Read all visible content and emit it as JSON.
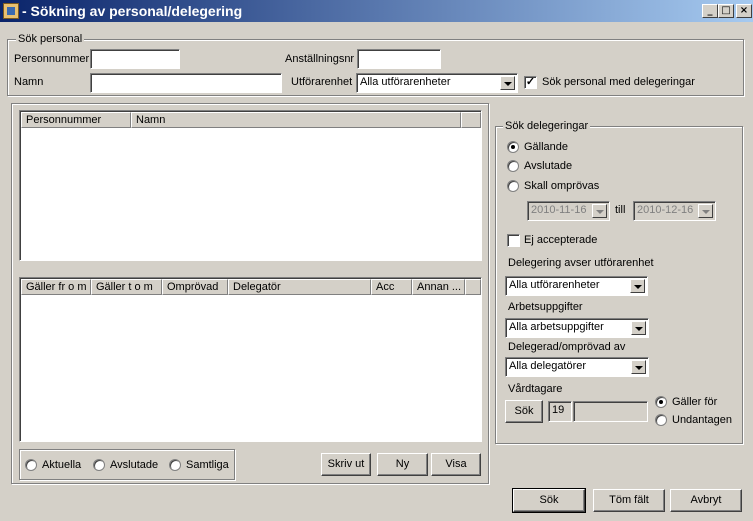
{
  "window": {
    "title": "- Sökning av personal/delegering",
    "minimize_glyph": "_",
    "maximize_glyph": "□",
    "close_glyph": "×"
  },
  "sok_personal": {
    "legend": "Sök personal",
    "personnummer_label": "Personnummer",
    "personnummer_value": "",
    "anstallningsnr_label": "Anställningsnr",
    "anstallningsnr_value": "",
    "namn_label": "Namn",
    "namn_value": "",
    "utforarenhet_label": "Utförarenhet",
    "utforarenhet_value": "Alla utförarenheter",
    "delegeringar_checkbox_label": "Sök personal med delegeringar",
    "delegeringar_checked": true
  },
  "personal_list": {
    "columns": [
      "Personnummer",
      "Namn"
    ],
    "rows": []
  },
  "delegering_list": {
    "columns": [
      "Gäller fr o m",
      "Gäller t o m",
      "Omprövad",
      "Delegatör",
      "Acc",
      "Annan ..."
    ],
    "rows": []
  },
  "filter": {
    "aktuella": "Aktuella",
    "avslutade": "Avslutade",
    "samtliga": "Samtliga"
  },
  "list_buttons": {
    "skriv_ut": "Skriv ut",
    "ny": "Ny",
    "visa": "Visa"
  },
  "sok_delegeringar": {
    "legend": "Sök delegeringar",
    "gallande": "Gällande",
    "avslutade": "Avslutade",
    "skall_omprovas": "Skall omprövas",
    "selected": "gallande",
    "date_from": "2010-11-16",
    "till_label": "till",
    "date_to": "2010-12-16",
    "ej_accepterade": "Ej accepterade",
    "ej_accepterade_checked": false,
    "utforarenhet_label": "Delegering avser utförarenhet",
    "utforarenhet_value": "Alla utförarenheter",
    "arbetsuppgifter_label": "Arbetsuppgifter",
    "arbetsuppgifter_value": "Alla arbetsuppgifter",
    "delegerad_label": "Delegerad/omprövad av",
    "delegerad_value": "Alla delegatörer",
    "vardtagare_label": "Vårdtagare",
    "sok_button": "Sök",
    "vardtagare_prefix": "19",
    "vardtagare_value": "",
    "galler_for": "Gäller för",
    "undantagen": "Undantagen"
  },
  "footer": {
    "sok": "Sök",
    "tom_falt": "Töm fält",
    "avbryt": "Avbryt"
  }
}
